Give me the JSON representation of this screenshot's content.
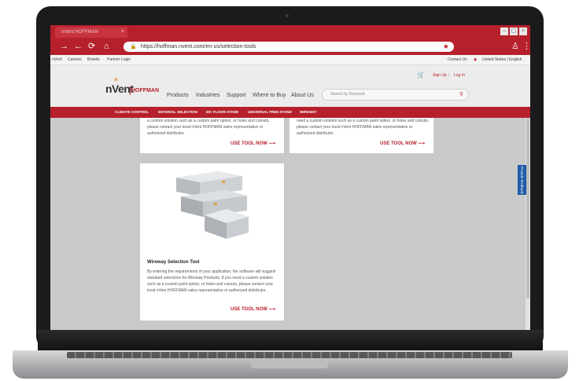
{
  "browser": {
    "tab_title": "nVent HOFFMAN",
    "url": "https://hoffman.nvent.com/en-us/selection-tools"
  },
  "utility_bar": {
    "left_links": [
      "nVent",
      "Careers",
      "Brands",
      "Partner Login"
    ],
    "contact": "Contact Us",
    "region": "United States | English"
  },
  "header": {
    "logo_main": "nVent",
    "logo_sub": "HOFFMAN",
    "sign_up": "Sign Up",
    "log_in": "Log In",
    "nav": [
      "Products",
      "Industries",
      "Support",
      "Where to Buy",
      "About Us"
    ],
    "search_placeholder": "Search by Keyword"
  },
  "category_bar": [
    "CLIMATE CONTROL",
    "MATERIAL SELECTION",
    "IEC FLOOR-STAND",
    "UNIVERSAL FREE-STAND",
    "WIREWAY"
  ],
  "cards_top": [
    {
      "text": "a custom solution such as a custom paint option, or holes and cutouts, please contact your local nVent HOFFMAN sales representative or authorized distributor.",
      "link": "USE TOOL NOW ⟶"
    },
    {
      "text": "need a custom solution such as a custom paint option, or holes and cutouts, please contact your local nVent HOFFMAN sales representative or authorized distributor.",
      "link": "USE TOOL NOW ⟶"
    }
  ],
  "wireway_card": {
    "title": "Wireway Selection Tool",
    "text": "By entering the requirements of your application, the software will suggest standard selections for Wireway Products. If you need a custom solution such as a custom paint option, or holes and cutouts, please contact your local nVent HOFFMAN sales representative or authorized distributor.",
    "link": "USE TOOL NOW ⟶"
  },
  "feedback": "Provide feedback",
  "colors": {
    "brand_red": "#b6202b",
    "feedback_blue": "#1e5aa8"
  }
}
